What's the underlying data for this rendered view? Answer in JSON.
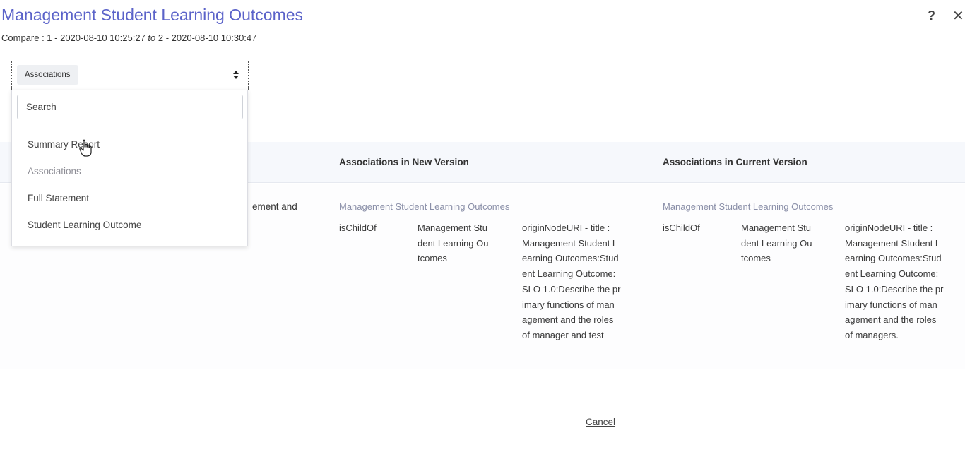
{
  "header": {
    "title": "Management Student Learning Outcomes",
    "compare_prefix": "Compare : 1 - 2020-08-10 10:25:27 ",
    "compare_to": "to",
    "compare_suffix": " 2 - 2020-08-10 10:30:47",
    "help_icon": "?",
    "close_icon": "✕"
  },
  "filter": {
    "selected": "Associations",
    "search_placeholder": "Search",
    "options": [
      "Summary Report",
      "Associations",
      "Full Statement",
      "Student Learning Outcome"
    ]
  },
  "table": {
    "headers": {
      "new": "Associations in New Version",
      "current": "Associations in Current Version"
    },
    "hidden_cell_fragment": "ement and",
    "new_version": {
      "node": "Management Student Learning Outcomes",
      "type": "isChildOf",
      "target_lines": [
        "Management Stu",
        "dent Learning Ou",
        "tcomes"
      ],
      "detail_lines": [
        "originNodeURI - title :",
        "Management Student L",
        "earning Outcomes:Stud",
        "ent Learning Outcome:",
        "SLO 1.0:Describe the pr",
        "imary functions of man",
        "agement and the roles",
        "of manager and test"
      ]
    },
    "current_version": {
      "node": "Management Student Learning Outcomes",
      "type": "isChildOf",
      "target_lines": [
        "Management Stu",
        "dent Learning Ou",
        "tcomes"
      ],
      "detail_lines": [
        "originNodeURI - title :",
        "Management Student L",
        "earning Outcomes:Stud",
        "ent Learning Outcome:",
        "SLO 1.0:Describe the pr",
        "imary functions of man",
        "agement and the roles",
        "of managers."
      ]
    }
  },
  "footer": {
    "cancel_label": "Cancel"
  },
  "colors": {
    "title": "#5b63c9",
    "header_band": "#f6f8fc",
    "muted_link": "#8a8fa8"
  },
  "icons": {
    "help": "question-icon",
    "close": "close-icon",
    "sort": "sort-icon",
    "cursor": "hand-cursor-icon"
  }
}
